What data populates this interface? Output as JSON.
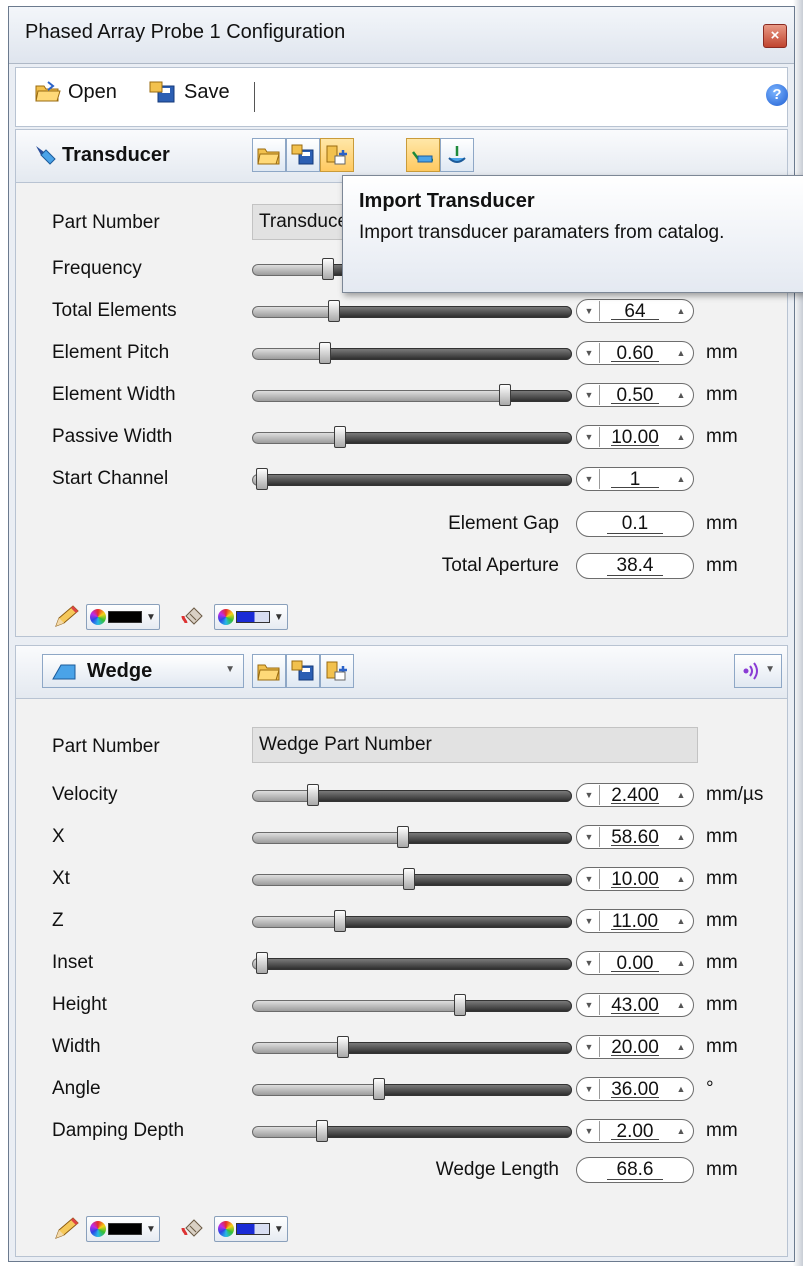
{
  "window": {
    "title": "Phased Array Probe 1 Configuration",
    "close_glyph": "×"
  },
  "toolbar": {
    "open_label": "Open",
    "save_label": "Save",
    "help_glyph": "?"
  },
  "transducer": {
    "title": "Transducer",
    "part_number_label": "Part Number",
    "part_number_value": "Transducer",
    "rows": [
      {
        "label": "Frequency",
        "value": "",
        "unit": "",
        "level": 0.22
      },
      {
        "label": "Total Elements",
        "value": "64",
        "unit": "",
        "level": 0.24
      },
      {
        "label": "Element Pitch",
        "value": "0.60",
        "unit": "mm",
        "level": 0.21
      },
      {
        "label": "Element Width",
        "value": "0.50",
        "unit": "mm",
        "level": 0.81
      },
      {
        "label": "Passive Width",
        "value": "10.00",
        "unit": "mm",
        "level": 0.26
      },
      {
        "label": "Start Channel",
        "value": "1",
        "unit": "",
        "level": 0.0
      }
    ],
    "element_gap_label": "Element Gap",
    "element_gap_value": "0.1",
    "element_gap_unit": "mm",
    "total_aperture_label": "Total Aperture",
    "total_aperture_value": "38.4",
    "total_aperture_unit": "mm",
    "line_color": "#000000",
    "fill_color": "#1a2bd6"
  },
  "tooltip": {
    "title": "Import Transducer",
    "description": "Import transducer paramaters from catalog."
  },
  "wedge": {
    "title": "Wedge",
    "part_number_label": "Part Number",
    "part_number_value": "Wedge Part Number",
    "rows": [
      {
        "label": "Velocity",
        "value": "2.400",
        "unit": "mm/µs",
        "level": 0.17
      },
      {
        "label": "X",
        "value": "58.60",
        "unit": "mm",
        "level": 0.47
      },
      {
        "label": "Xt",
        "value": "10.00",
        "unit": "mm",
        "level": 0.49
      },
      {
        "label": "Z",
        "value": "11.00",
        "unit": "mm",
        "level": 0.26
      },
      {
        "label": "Inset",
        "value": "0.00",
        "unit": "mm",
        "level": 0.0
      },
      {
        "label": "Height",
        "value": "43.00",
        "unit": "mm",
        "level": 0.66
      },
      {
        "label": "Width",
        "value": "20.00",
        "unit": "mm",
        "level": 0.27
      },
      {
        "label": "Angle",
        "value": "36.00",
        "unit": "°",
        "level": 0.39
      },
      {
        "label": "Damping Depth",
        "value": "2.00",
        "unit": "mm",
        "level": 0.2
      }
    ],
    "wedge_length_label": "Wedge Length",
    "wedge_length_value": "68.6",
    "wedge_length_unit": "mm"
  }
}
